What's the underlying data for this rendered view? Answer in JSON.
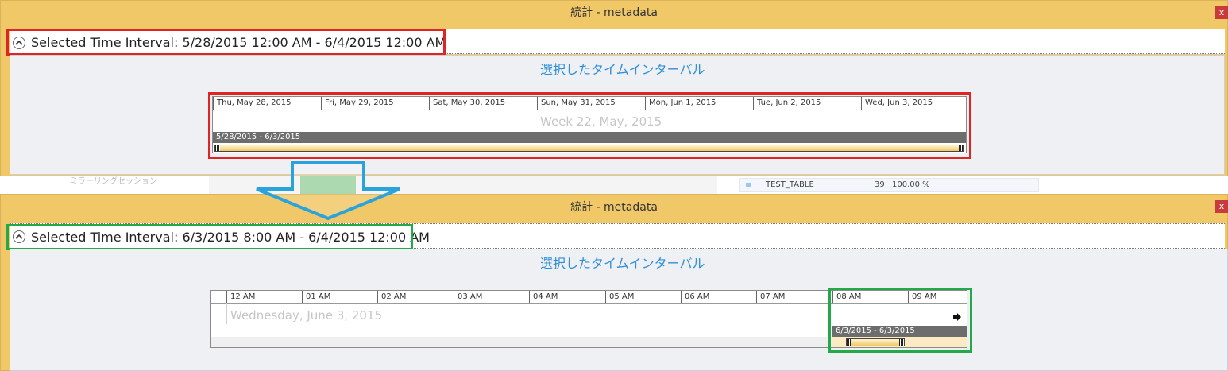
{
  "top": {
    "window_title": "統計 - metadata",
    "close_label": "x",
    "interval_text": "Selected Time Interval: 5/28/2015 12:00 AM - 6/4/2015 12:00 AM",
    "subtitle": "選択したタイムインターバル",
    "days": [
      "Thu, May 28, 2015",
      "Fri, May 29, 2015",
      "Sat, May 30, 2015",
      "Sun, May 31, 2015",
      "Mon, Jun 1, 2015",
      "Tue, Jun 2, 2015",
      "Wed, Jun 3, 2015"
    ],
    "week_label": "Week 22, May, 2015",
    "range_label": "5/28/2015 - 6/3/2015"
  },
  "background": {
    "left_faded_text": "ミラーリングセッション",
    "table_name": "TEST_TABLE",
    "table_count": "39",
    "table_percent": "100.00 %"
  },
  "bottom": {
    "window_title": "統計 - metadata",
    "close_label": "x",
    "interval_text": "Selected Time Interval: 6/3/2015 8:00 AM - 6/4/2015 12:00 AM",
    "subtitle": "選択したタイムインターバル",
    "hours": [
      "12 AM",
      "01 AM",
      "02 AM",
      "03 AM",
      "04 AM",
      "05 AM",
      "06 AM",
      "07 AM",
      "08 AM",
      "09 AM"
    ],
    "day_label": "Wednesday, June 3, 2015",
    "range_label": "6/3/2015 - 6/3/2015"
  },
  "colors": {
    "title_bar": "#f0c868",
    "highlight_red": "#e02424",
    "highlight_green": "#23a84a",
    "arrow_blue": "#2aa2dc",
    "subtitle_blue": "#2f8fd6"
  },
  "icons": [
    "collapse-icon",
    "close-icon",
    "arrow-right-icon",
    "down-arrow-icon"
  ]
}
